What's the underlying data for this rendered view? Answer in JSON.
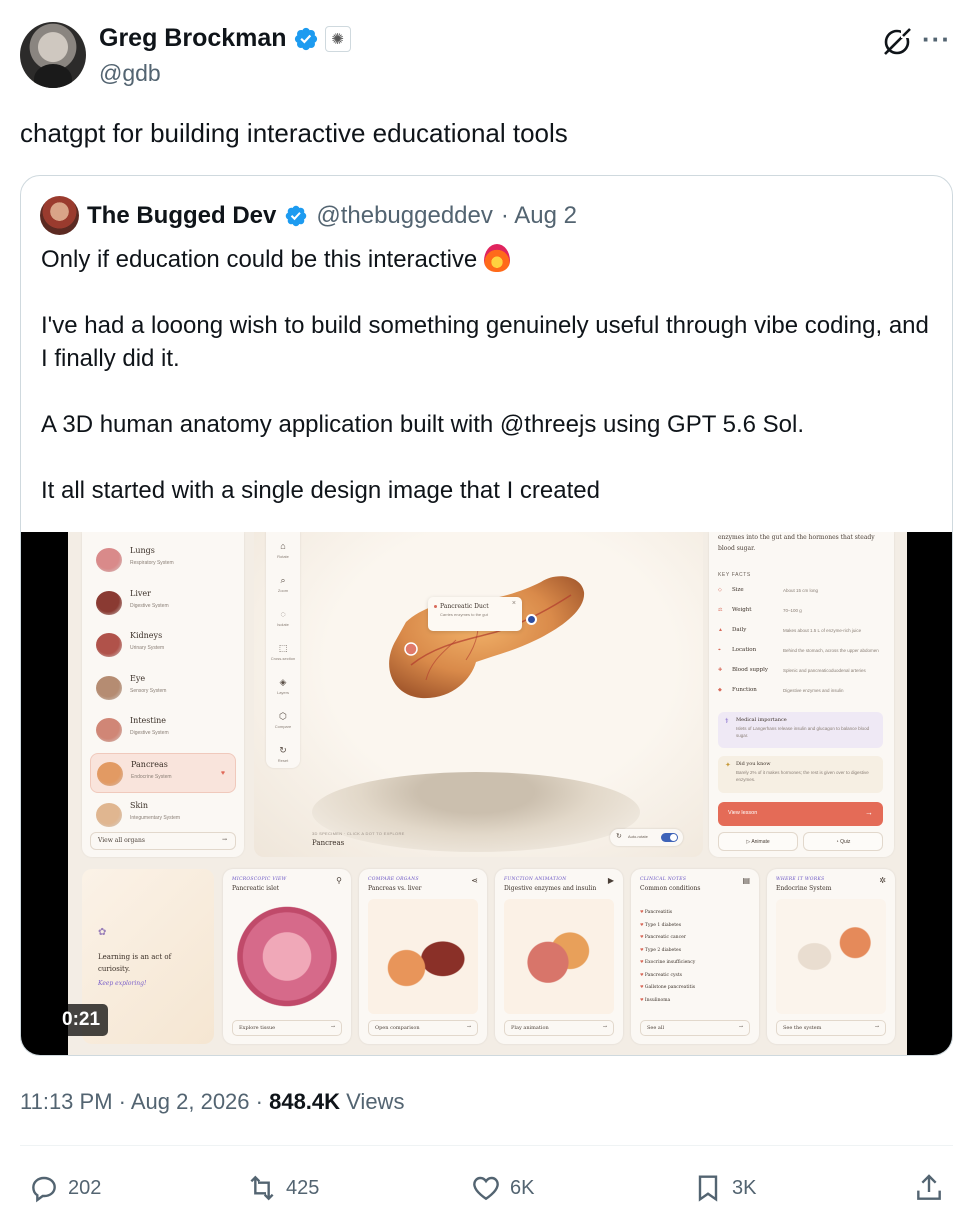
{
  "author": {
    "name": "Greg Brockman",
    "handle": "@gdb"
  },
  "tweet": {
    "text": "chatgpt for building interactive educational tools"
  },
  "quote": {
    "name": "The Bugged Dev",
    "handle": "@thebuggeddev",
    "date": "· Aug 2",
    "para1": "Only if education could be this interactive",
    "para2": "I've had a looong wish to build something genuinely useful through vibe coding, and I finally did it.",
    "para3": "A 3D human anatomy application built with @threejs using GPT 5.6 Sol.",
    "para4": "It all started with a single design image that I created"
  },
  "video": {
    "duration": "0:21",
    "organs": [
      {
        "name": "Lungs",
        "system": "Respiratory System",
        "color": "#d98a8a"
      },
      {
        "name": "Liver",
        "system": "Digestive System",
        "color": "#8a3a32"
      },
      {
        "name": "Kidneys",
        "system": "Urinary System",
        "color": "#b0524a"
      },
      {
        "name": "Eye",
        "system": "Sensory System",
        "color": "#b58c72"
      },
      {
        "name": "Intestine",
        "system": "Digestive System",
        "color": "#d08676"
      },
      {
        "name": "Pancreas",
        "system": "Endocrine System",
        "color": "#e29a63"
      },
      {
        "name": "Skin",
        "system": "Integumentary System",
        "color": "#e0b690"
      }
    ],
    "view_all": "View all organs",
    "tools": [
      {
        "icon": "⌂",
        "label": "Rotate"
      },
      {
        "icon": "⌕",
        "label": "Zoom"
      },
      {
        "icon": "◌",
        "label": "Isolate"
      },
      {
        "icon": "⬚",
        "label": "Cross-section"
      },
      {
        "icon": "◈",
        "label": "Layers"
      },
      {
        "icon": "⬡",
        "label": "Compare"
      },
      {
        "icon": "↻",
        "label": "Reset"
      }
    ],
    "tooltip": {
      "title": "Pancreatic Duct",
      "desc": "Carries enzymes to the gut"
    },
    "specimen_label": "3D SPECIMEN · CLICK A DOT TO EXPLORE",
    "specimen_name": "Pancreas",
    "autorotate": "Auto-rotate",
    "info_desc": "enzymes into the gut and the hormones that steady blood sugar.",
    "key_facts_heading": "KEY FACTS",
    "key_facts": [
      {
        "icon": "◇",
        "label": "Size",
        "value": "About 15 cm long"
      },
      {
        "icon": "⚖",
        "label": "Weight",
        "value": "70–100 g"
      },
      {
        "icon": "▲",
        "label": "Daily",
        "value": "Makes about 1.5 L of enzyme-rich juice"
      },
      {
        "icon": "⌖",
        "label": "Location",
        "value": "Behind the stomach, across the upper abdomen"
      },
      {
        "icon": "✚",
        "label": "Blood supply",
        "value": "Splenic and pancreaticoduodenal arteries"
      },
      {
        "icon": "◆",
        "label": "Function",
        "value": "Digestive enzymes and insulin"
      }
    ],
    "medical": {
      "title": "Medical importance",
      "text": "Islets of Langerhans release insulin and glucagon to balance blood sugar."
    },
    "did_you_know": {
      "title": "Did you know",
      "text": "Barely 2% of it makes hormones; the rest is given over to digestive enzymes."
    },
    "view_lesson": "View lesson",
    "animate": "Animate",
    "quiz": "Quiz",
    "curiosity": {
      "line1": "Learning is an act of curiosity.",
      "line2": "Keep exploring!"
    },
    "cards": [
      {
        "tag": "MICROSCOPIC VIEW",
        "title": "Pancreatic islet",
        "icon": "⚲",
        "action": "Explore tissue"
      },
      {
        "tag": "COMPARE ORGANS",
        "title": "Pancreas vs. liver",
        "icon": "⋖",
        "action": "Open comparison"
      },
      {
        "tag": "FUNCTION ANIMATION",
        "title": "Digestive enzymes and insulin",
        "icon": "▶",
        "action": "Play animation"
      },
      {
        "tag": "CLINICAL NOTES",
        "title": "Common conditions",
        "icon": "▤",
        "action": "See all"
      },
      {
        "tag": "WHERE IT WORKS",
        "title": "Endocrine System",
        "icon": "✲",
        "action": "See the system"
      }
    ],
    "conditions": [
      "Pancreatitis",
      "Type 1 diabetes",
      "Pancreatic cancer",
      "Type 2 diabetes",
      "Exocrine insufficiency",
      "Pancreatic cysts",
      "Gallstone pancreatitis",
      "Insulinoma"
    ]
  },
  "meta": {
    "time": "11:13 PM · Aug 2, 2026 · ",
    "views": "848.4K",
    "views_label": " Views"
  },
  "actions": {
    "replies": "202",
    "reposts": "425",
    "likes": "6K",
    "bookmarks": "3K"
  },
  "colors": {
    "accent": "#1d9bf0",
    "muted": "#536471",
    "primary_text": "#0f1419",
    "lesson_button": "#e46b57"
  }
}
